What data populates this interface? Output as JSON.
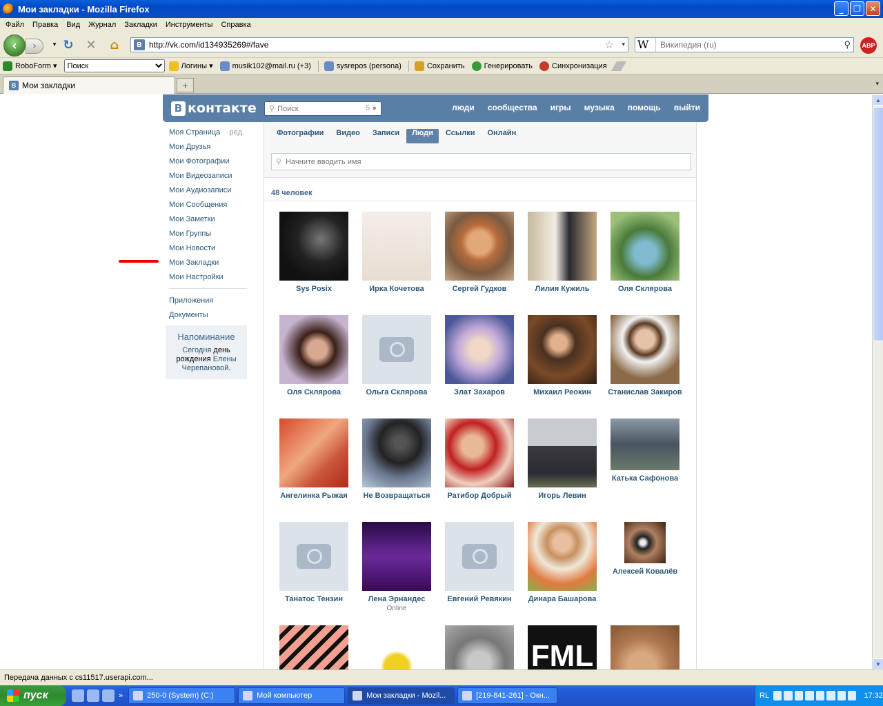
{
  "window": {
    "title": "Мои закладки - Mozilla Firefox"
  },
  "menu": [
    "Файл",
    "Правка",
    "Вид",
    "Журнал",
    "Закладки",
    "Инструменты",
    "Справка"
  ],
  "nav": {
    "url": "http://vk.com/id134935269#/fave",
    "search_placeholder": "Википедия (ru)",
    "search_engine_letter": "W",
    "abp": "ABP"
  },
  "bookmarks_bar": {
    "roboform": "RoboForm",
    "search_value": "Поиск",
    "items": [
      "Логины",
      "musik102@mail.ru (+3)",
      "sysrepos (persona)",
      "Сохранить",
      "Генерировать",
      "Синхронизация"
    ]
  },
  "tab": {
    "label": "Мои закладки",
    "favicon": "B"
  },
  "vk": {
    "logo": "контакте",
    "logo_letter": "В",
    "search_placeholder": "Поиск",
    "search_count": "5",
    "nav": [
      "люди",
      "сообщества",
      "игры",
      "музыка",
      "помощь",
      "выйти"
    ],
    "left_menu": [
      "Моя Страница",
      "Мои Друзья",
      "Мои Фотографии",
      "Мои Видеозаписи",
      "Мои Аудиозаписи",
      "Мои Сообщения",
      "Мои Заметки",
      "Мои Группы",
      "Мои Новости",
      "Мои Закладки",
      "Мои Настройки"
    ],
    "edit_label": "ред.",
    "left_menu_extra": [
      "Приложения",
      "Документы"
    ],
    "reminder": {
      "title": "Напоминание",
      "t1": "Сегодня",
      "t2": " день рождения ",
      "t3": "Елены Черепановой",
      "t4": "."
    },
    "tabs": [
      "Фотографии",
      "Видео",
      "Записи",
      "Люди",
      "Ссылки",
      "Онлайн"
    ],
    "active_tab": "Люди",
    "people_search_placeholder": "Начните вводить имя",
    "count": "48 человек",
    "people": [
      {
        "name": "Sys Posix",
        "photo": "dark-photo"
      },
      {
        "name": "Ирка Кочетова",
        "photo": "lighter-photo"
      },
      {
        "name": "Сергей Гудков",
        "photo": "man-photo"
      },
      {
        "name": "Лилия Кужиль",
        "photo": "wedding-photo"
      },
      {
        "name": "Оля Склярова",
        "photo": "forest-photo"
      },
      {
        "name": "Оля Склярова",
        "photo": "girl-photo"
      },
      {
        "name": "Ольга Склярова",
        "photo": "camera-placeholder"
      },
      {
        "name": "Злат Захаров",
        "photo": "art-photo"
      },
      {
        "name": "Михаил Реокин",
        "photo": "man-sitting-photo"
      },
      {
        "name": "Станислав Закиров",
        "photo": "man-tie-photo"
      },
      {
        "name": "Ангелинка Рыжая",
        "photo": "red-photo"
      },
      {
        "name": "Не Возвращаться",
        "photo": "hood-photo"
      },
      {
        "name": "Ратибор Добрый",
        "photo": "tinsel-photo"
      },
      {
        "name": "Игорь Левин",
        "photo": "outdoor-photo"
      },
      {
        "name": "Катька Сафонова",
        "photo": "city-photo"
      },
      {
        "name": "Танатос Тензин",
        "photo": "camera-placeholder"
      },
      {
        "name": "Лена Эрнандес",
        "photo": "purple-photo",
        "status": "Online"
      },
      {
        "name": "Евгений Ревякин",
        "photo": "camera-placeholder"
      },
      {
        "name": "Динара Башарова",
        "photo": "flowers-photo"
      },
      {
        "name": "Алексей Ковалёв",
        "photo": "camera-man-photo"
      },
      {
        "name": "",
        "photo": "ladder-art"
      },
      {
        "name": "",
        "photo": "lego-photo"
      },
      {
        "name": "",
        "photo": "gray-photo"
      },
      {
        "name": "",
        "photo": "fml-photo",
        "text": "FML"
      },
      {
        "name": "",
        "photo": "face-photo"
      }
    ]
  },
  "status_bar": "Передача данных с cs11517.userapi.com...",
  "taskbar": {
    "start": "пуск",
    "tasks": [
      "250-0 (System) (C:)",
      "Мой компьютер",
      "Мои закладки - Mozil...",
      "[219-841-261] - Окн..."
    ],
    "active_task": 2,
    "lang": "RL",
    "clock": "17:32"
  }
}
